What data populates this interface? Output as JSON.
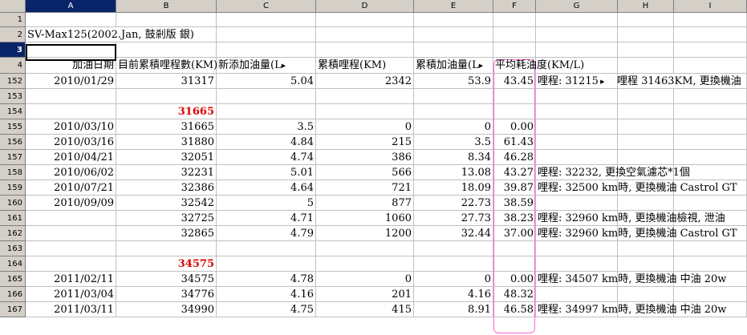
{
  "columns": [
    "A",
    "B",
    "C",
    "D",
    "E",
    "F",
    "G",
    "H",
    "I"
  ],
  "selected_column": "A",
  "selected_row": "3",
  "rows": [
    {
      "num": "1",
      "cells": {}
    },
    {
      "num": "2",
      "cells": {
        "A": "SV-Max125(2002.Jan, 鼓剎版 銀)"
      }
    },
    {
      "num": "3",
      "cells": {}
    },
    {
      "num": "4",
      "cells": {
        "A": "加油日期",
        "B": "目前累積哩程數(KM)",
        "C": "新添加油量(L",
        "D": "累積哩程(KM)",
        "E": "累積加油量(L",
        "F": "平均耗油度(KM/L)"
      }
    },
    {
      "num": "152",
      "cells": {
        "A": "2010/01/29",
        "B": "31317",
        "C": "5.04",
        "D": "2342",
        "E": "53.9",
        "F": "43.45",
        "G": "哩程: 31215",
        "H": "哩程 31463KM, 更換機油"
      }
    },
    {
      "num": "153",
      "cells": {}
    },
    {
      "num": "154",
      "cells": {
        "B": "31665"
      }
    },
    {
      "num": "155",
      "cells": {
        "A": "2010/03/10",
        "B": "31665",
        "C": "3.5",
        "D": "0",
        "E": "0",
        "F": "0.00"
      }
    },
    {
      "num": "156",
      "cells": {
        "A": "2010/03/16",
        "B": "31880",
        "C": "4.84",
        "D": "215",
        "E": "3.5",
        "F": "61.43"
      }
    },
    {
      "num": "157",
      "cells": {
        "A": "2010/04/21",
        "B": "32051",
        "C": "4.74",
        "D": "386",
        "E": "8.34",
        "F": "46.28"
      }
    },
    {
      "num": "158",
      "cells": {
        "A": "2010/06/02",
        "B": "32231",
        "C": "5.01",
        "D": "566",
        "E": "13.08",
        "F": "43.27",
        "G": "哩程: 32232, 更換空氣濾芯*1個"
      }
    },
    {
      "num": "159",
      "cells": {
        "A": "2010/07/21",
        "B": "32386",
        "C": "4.64",
        "D": "721",
        "E": "18.09",
        "F": "39.87",
        "G": "哩程: 32500 km時, 更換機油 Castrol GT"
      }
    },
    {
      "num": "160",
      "cells": {
        "A": "2010/09/09",
        "B": "32542",
        "C": "5",
        "D": "877",
        "E": "22.73",
        "F": "38.59"
      }
    },
    {
      "num": "161",
      "cells": {
        "B": "32725",
        "C": "4.71",
        "D": "1060",
        "E": "27.73",
        "F": "38.23",
        "G": "哩程: 32960 km時, 更換機油檢視, 泄油"
      }
    },
    {
      "num": "162",
      "cells": {
        "B": "32865",
        "C": "4.79",
        "D": "1200",
        "E": "32.44",
        "F": "37.00",
        "G": "哩程: 32960 km時, 更換機油 Castrol GT"
      }
    },
    {
      "num": "163",
      "cells": {}
    },
    {
      "num": "164",
      "cells": {
        "B": "34575"
      }
    },
    {
      "num": "165",
      "cells": {
        "A": "2011/02/11",
        "B": "34575",
        "C": "4.78",
        "D": "0",
        "E": "0",
        "F": "0.00",
        "G": "哩程: 34507 km時, 更換機油 中油 20w"
      }
    },
    {
      "num": "166",
      "cells": {
        "A": "2011/03/04",
        "B": "34776",
        "C": "4.16",
        "D": "201",
        "E": "4.16",
        "F": "48.32"
      }
    },
    {
      "num": "167",
      "cells": {
        "A": "2011/03/11",
        "B": "34990",
        "C": "4.75",
        "D": "415",
        "E": "8.91",
        "F": "46.58",
        "G": "哩程: 34997 km時, 更換機油 中油 20w"
      }
    }
  ],
  "colors": {
    "header_bg": "#d4d0c8",
    "selected_header_bg": "#0a246a",
    "red_text": "#e00000",
    "highlight_border": "#ff66cc"
  }
}
